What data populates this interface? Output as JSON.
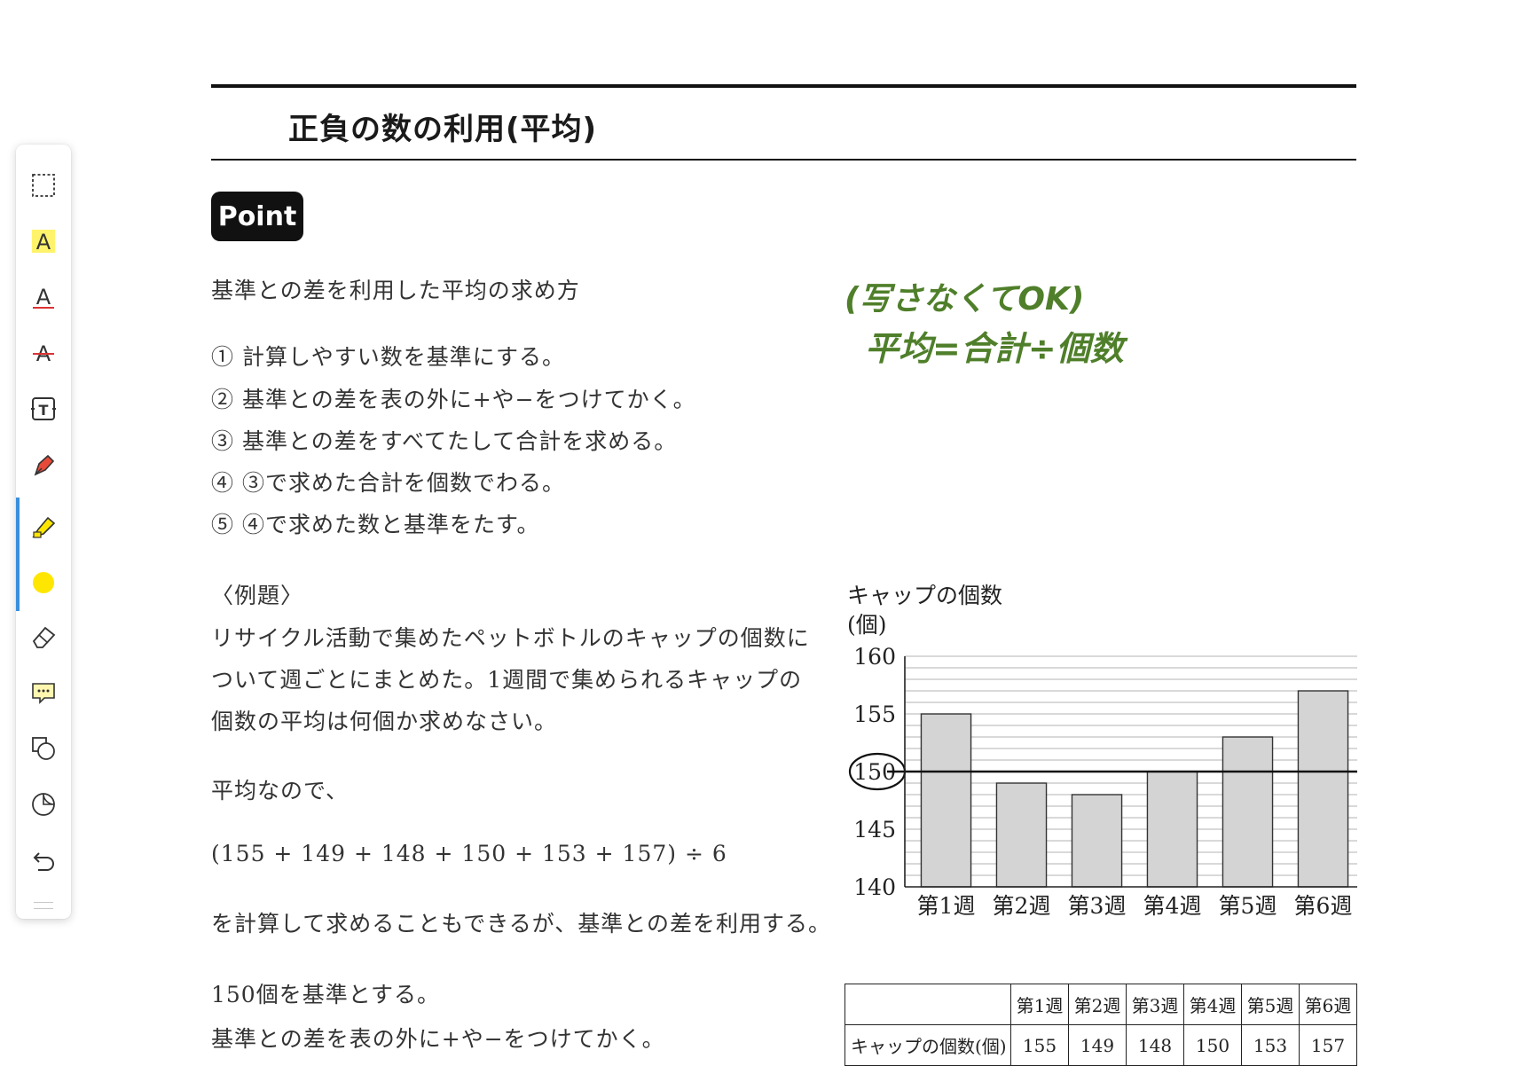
{
  "document": {
    "title": "正負の数の利用(平均)",
    "badge": "Point",
    "intro": "基準との差を利用した平均の求め方",
    "steps": [
      "① 計算しやすい数を基準にする。",
      "② 基準との差を表の外に+や−をつけてかく。",
      "③ 基準との差をすべてたして合計を求める。",
      "④ ③で求めた合計を個数でわる。",
      "⑤ ④で求めた数と基準をたす。"
    ],
    "example_heading": "〈例題〉",
    "example_lines": [
      "リサイクル活動で集めたペットボトルのキャップの個数に",
      "ついて週ごとにまとめた。1週間で集められるキャップの",
      "個数の平均は何個か求めなさい。"
    ],
    "since_average": "平均なので、",
    "formula": "(155 + 149 + 148 + 150 + 153 + 157) ÷ 6",
    "alt_method": "を計算して求めることもできるが、基準との差を利用する。",
    "baseline_line": "150個を基準とする。",
    "diff_line": "基準との差を表の外に+や−をつけてかく。",
    "handwritten_note_1": "(写さなくてOK)",
    "handwritten_note_2": "平均=合計÷個数"
  },
  "table": {
    "row_label": "キャップの個数(個)",
    "headers": [
      "第1週",
      "第2週",
      "第3週",
      "第4週",
      "第5週",
      "第6週"
    ],
    "values": [
      "155",
      "149",
      "148",
      "150",
      "153",
      "157"
    ]
  },
  "chart_data": {
    "type": "bar",
    "title": "キャップの個数",
    "ylabel": "(個)",
    "categories": [
      "第1週",
      "第2週",
      "第3週",
      "第4週",
      "第5週",
      "第6週"
    ],
    "values": [
      155,
      149,
      148,
      150,
      153,
      157
    ],
    "ylim": [
      140,
      160
    ],
    "yticks": [
      140,
      145,
      150,
      155,
      160
    ],
    "grid": true,
    "reference_line": 150,
    "bar_color": "#d4d4d4"
  },
  "toolbar": {
    "active_tool": "highlighter",
    "active_color": "#ffe600",
    "tools": [
      "select-icon",
      "text-highlight-icon",
      "text-underline-icon",
      "text-strikethrough-icon",
      "text-box-icon",
      "pen-icon",
      "highlighter-icon",
      "color-swatch-icon",
      "eraser-icon",
      "comment-icon",
      "shapes-icon",
      "sticker-icon",
      "undo-icon"
    ]
  }
}
